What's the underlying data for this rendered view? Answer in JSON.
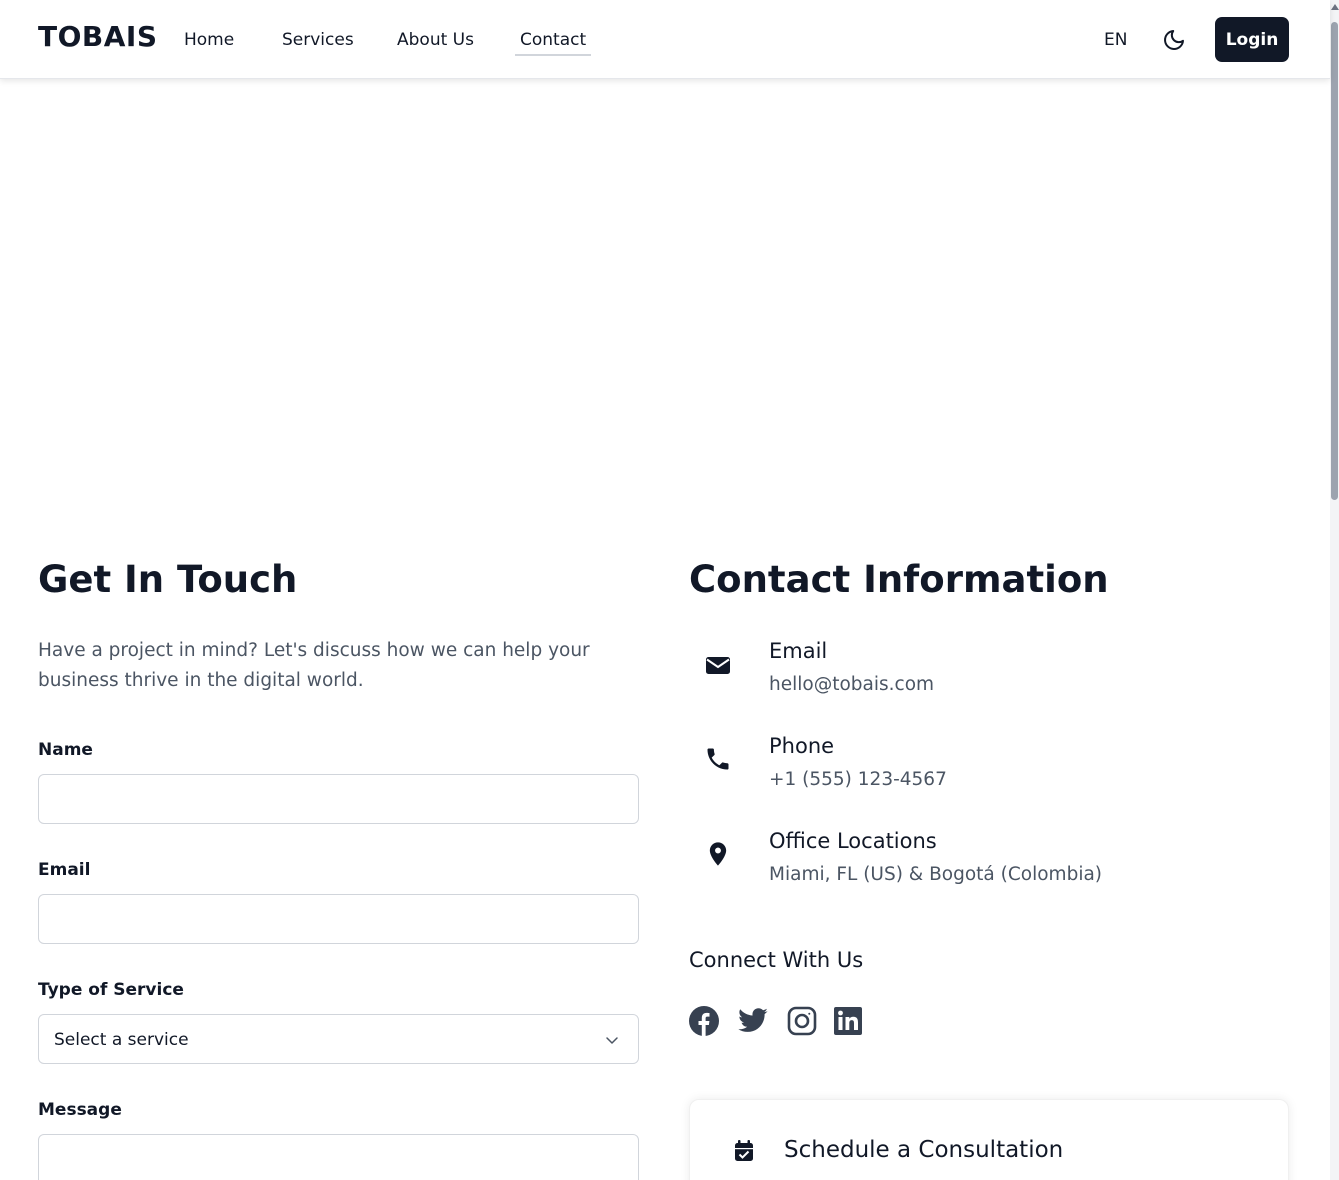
{
  "header": {
    "brand": "TOBAIS",
    "nav": [
      {
        "label": "Home"
      },
      {
        "label": "Services"
      },
      {
        "label": "About Us"
      },
      {
        "label": "Contact",
        "active": true
      }
    ],
    "language": "EN",
    "login_label": "Login"
  },
  "contact_form": {
    "title": "Get In Touch",
    "intro": "Have a project in mind? Let's discuss how we can help your business thrive in the digital world.",
    "name_label": "Name",
    "name_value": "",
    "email_label": "Email",
    "email_value": "",
    "service_label": "Type of Service",
    "service_selected": "Select a service",
    "message_label": "Message",
    "message_value": ""
  },
  "contact_info": {
    "title": "Contact Information",
    "items": [
      {
        "icon": "envelope-icon",
        "title": "Email",
        "value": "hello@tobais.com"
      },
      {
        "icon": "phone-icon",
        "title": "Phone",
        "value": "+1 (555) 123-4567"
      },
      {
        "icon": "map-pin-icon",
        "title": "Office Locations",
        "value": "Miami, FL (US) & Bogotá (Colombia)"
      }
    ],
    "connect_title": "Connect With Us",
    "social": [
      "facebook-icon",
      "twitter-icon",
      "instagram-icon",
      "linkedin-icon"
    ],
    "consultation_title": "Schedule a Consultation"
  },
  "colors": {
    "primary": "#111827",
    "muted_text": "#4b5563",
    "border": "#d1d5db",
    "social_icon": "#374151"
  }
}
